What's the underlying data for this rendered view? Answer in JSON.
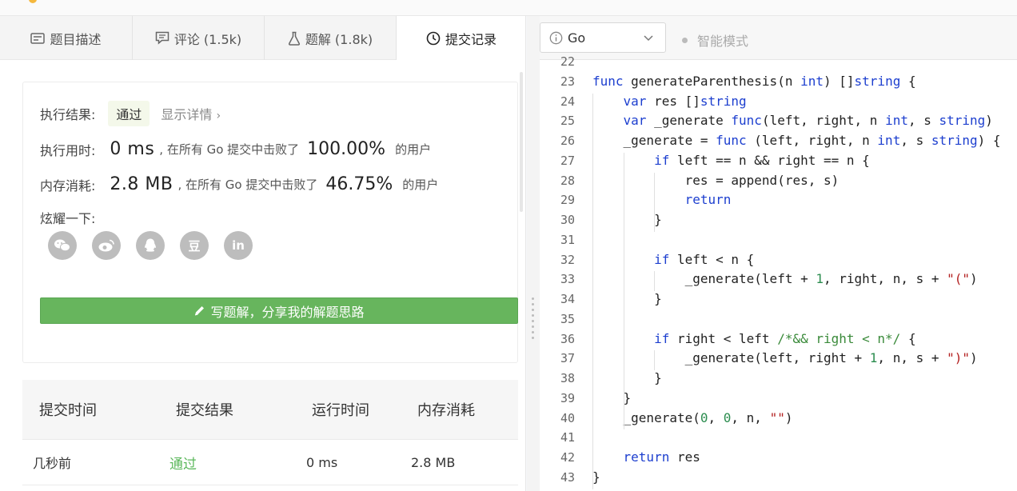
{
  "tabs": [
    {
      "label": "题目描述",
      "icon": "description-icon"
    },
    {
      "label": "评论 (1.5k)",
      "icon": "comment-icon"
    },
    {
      "label": "题解 (1.8k)",
      "icon": "flask-icon"
    },
    {
      "label": "提交记录",
      "icon": "clock-icon"
    }
  ],
  "result": {
    "exec_result_label": "执行结果:",
    "status": "通过",
    "show_details": "显示详情",
    "runtime_label": "执行用时:",
    "runtime_value": "0 ms",
    "runtime_beat_text": ", 在所有 Go 提交中击败了",
    "runtime_pct": "100.00%",
    "runtime_users": "的用户",
    "memory_label": "内存消耗:",
    "memory_value": "2.8 MB",
    "memory_beat_text": ", 在所有 Go 提交中击败了",
    "memory_pct": "46.75%",
    "memory_users": "的用户",
    "share_label": "炫耀一下:",
    "share_icons": [
      "wechat-icon",
      "weibo-icon",
      "qq-icon",
      "douban-icon",
      "linkedin-icon"
    ],
    "share_glyphs": [
      "",
      "",
      "",
      "豆",
      "in"
    ],
    "write_solution": "写题解，分享我的解题思路"
  },
  "table": {
    "headers": [
      "提交时间",
      "提交结果",
      "运行时间",
      "内存消耗"
    ],
    "rows": [
      {
        "time": "几秒前",
        "result": "通过",
        "runtime": "0 ms",
        "memory": "2.8 MB"
      }
    ]
  },
  "editor": {
    "language": "Go",
    "smart_mode": "智能模式",
    "colors": {
      "keyword": "#1d3fcf",
      "number": "#2c8d4f",
      "string": "#b32020",
      "comment": "#3a8a3a"
    }
  },
  "code_lines": [
    {
      "n": "22",
      "html": ""
    },
    {
      "n": "23",
      "html": "<span class=\"kw\">func</span> generateParenthesis(n <span class=\"tp\">int</span>) []<span class=\"tp\">string</span> {"
    },
    {
      "n": "24",
      "html": "    <span class=\"kw\">var</span> res []<span class=\"tp\">string</span>"
    },
    {
      "n": "25",
      "html": "    <span class=\"kw\">var</span> _generate <span class=\"kw\">func</span>(left, right, n <span class=\"tp\">int</span>, s <span class=\"tp\">string</span>)"
    },
    {
      "n": "26",
      "html": "    _generate = <span class=\"kw\">func</span> (left, right, n <span class=\"tp\">int</span>, s <span class=\"tp\">string</span>) {"
    },
    {
      "n": "27",
      "html": "        <span class=\"kw\">if</span> left == n &amp;&amp; right == n {"
    },
    {
      "n": "28",
      "html": "            res = append(res, s)"
    },
    {
      "n": "29",
      "html": "            <span class=\"kw\">return</span>"
    },
    {
      "n": "30",
      "html": "        }"
    },
    {
      "n": "31",
      "html": ""
    },
    {
      "n": "32",
      "html": "        <span class=\"kw\">if</span> left &lt; n {"
    },
    {
      "n": "33",
      "html": "            _generate(left + <span class=\"num\">1</span>, right, n, s + <span class=\"str\">\"(\"</span>)"
    },
    {
      "n": "34",
      "html": "        }"
    },
    {
      "n": "35",
      "html": ""
    },
    {
      "n": "36",
      "html": "        <span class=\"kw\">if</span> right &lt; left <span class=\"cm\">/*&amp;&amp; right &lt; n*/</span> {"
    },
    {
      "n": "37",
      "html": "            _generate(left, right + <span class=\"num\">1</span>, n, s + <span class=\"str\">\")\"</span>)"
    },
    {
      "n": "38",
      "html": "        }"
    },
    {
      "n": "39",
      "html": "    }"
    },
    {
      "n": "40",
      "html": "    _generate(<span class=\"num\">0</span>, <span class=\"num\">0</span>, n, <span class=\"str\">\"\"</span>)"
    },
    {
      "n": "41",
      "html": ""
    },
    {
      "n": "42",
      "html": "    <span class=\"kw\">return</span> res"
    },
    {
      "n": "43",
      "html": "}"
    }
  ]
}
